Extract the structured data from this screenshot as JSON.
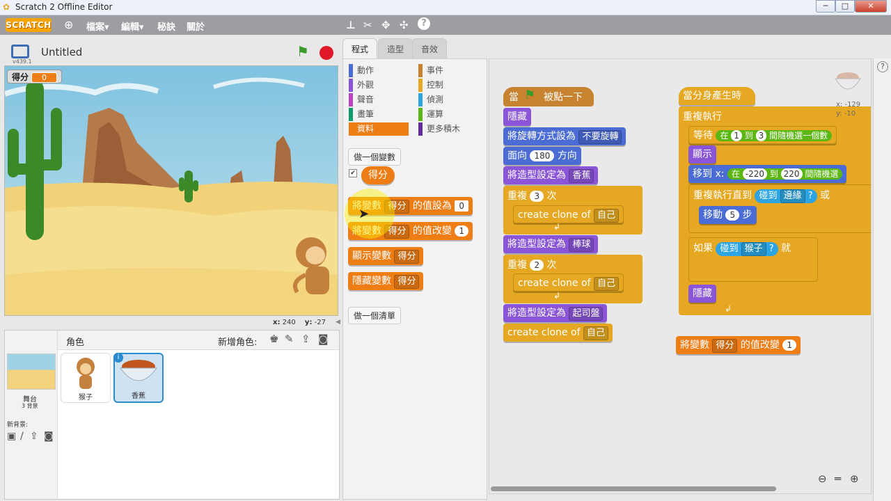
{
  "window": {
    "title": "Scratch 2 Offline Editor",
    "minimize": "─",
    "maximize": "□",
    "close": "✕"
  },
  "menubar": {
    "logo": "SCRATCH",
    "globe_icon": "globe-icon",
    "items": [
      "檔案▾",
      "編輯▾",
      "秘訣",
      "關於"
    ],
    "tools": [
      "duplicate-icon",
      "delete-icon",
      "grow-icon",
      "shrink-icon",
      "help-icon"
    ]
  },
  "stage": {
    "project_title": "Untitled",
    "version": "v439.1",
    "monitor": {
      "label": "得分",
      "value": "0"
    },
    "coords": {
      "x_label": "x:",
      "x": "240",
      "y_label": "y:",
      "y": "-27"
    }
  },
  "sprites": {
    "header": "角色",
    "new_sprite": "新增角色:",
    "stage_name": "舞台",
    "stage_backdrops": "3 背景",
    "new_backdrop": "新背景:",
    "items": [
      {
        "name": "猴子"
      },
      {
        "name": "香蕉"
      }
    ]
  },
  "tabs": [
    "程式",
    "造型",
    "音效"
  ],
  "categories": {
    "left": [
      {
        "label": "動作",
        "color": "#4a6cd4"
      },
      {
        "label": "外觀",
        "color": "#8a55d7"
      },
      {
        "label": "聲音",
        "color": "#bb42c3"
      },
      {
        "label": "畫筆",
        "color": "#0e9a6c"
      },
      {
        "label": "資料",
        "color": "#ee7d16",
        "selected": true
      }
    ],
    "right": [
      {
        "label": "事件",
        "color": "#c88330"
      },
      {
        "label": "控制",
        "color": "#e6a822"
      },
      {
        "label": "偵測",
        "color": "#2ca5e2"
      },
      {
        "label": "運算",
        "color": "#5cb712"
      },
      {
        "label": "更多積木",
        "color": "#632d99"
      }
    ]
  },
  "palette": {
    "make_variable": "做一個變數",
    "var_reporter": "得分",
    "set_block": {
      "a": "將變數",
      "var": "得分",
      "b": "的值設為",
      "val": "0"
    },
    "change_block": {
      "a": "將變數",
      "var": "得分",
      "b": "的值改變",
      "val": "1"
    },
    "show_var": {
      "a": "顯示變數",
      "var": "得分"
    },
    "hide_var": {
      "a": "隱藏變數",
      "var": "得分"
    },
    "make_list": "做一個清單"
  },
  "script1": {
    "hat": {
      "a": "當",
      "b": "被點一下"
    },
    "hide": "隱藏",
    "rot": {
      "a": "將旋轉方式設為",
      "v": "不要旋轉"
    },
    "point": {
      "a": "面向",
      "v": "180",
      "b": "方向"
    },
    "costume1": {
      "a": "將造型設定為",
      "v": "香蕉"
    },
    "repeat1": {
      "a": "重複",
      "v": "3",
      "b": "次"
    },
    "clone": {
      "a": "create clone of",
      "v": "自己"
    },
    "costume2": {
      "a": "將造型設定為",
      "v": "棒球"
    },
    "repeat2": {
      "a": "重複",
      "v": "2",
      "b": "次"
    },
    "costume3": {
      "a": "將造型設定為",
      "v": "起司盤"
    }
  },
  "script2": {
    "hat": "當分身產生時",
    "forever": "重複執行",
    "wait": {
      "a": "等待",
      "b": "在",
      "v1": "1",
      "c": "到",
      "v2": "3",
      "d": "間隨機選一個數"
    },
    "show": "顯示",
    "goto": {
      "a": "移到 x:",
      "b": "在",
      "v1": "-220",
      "c": "到",
      "v2": "220",
      "d": "間隨機選"
    },
    "until": {
      "a": "重複執行直到",
      "b": "碰到",
      "v": "邊緣",
      "c": "?",
      "d": "或"
    },
    "move": {
      "a": "移動",
      "v": "5",
      "b": "步"
    },
    "if": {
      "a": "如果",
      "b": "碰到",
      "v": "猴子",
      "c": "?",
      "d": "就"
    },
    "hide": "隱藏"
  },
  "loose_block": {
    "a": "將變數",
    "var": "得分",
    "b": "的值改變",
    "val": "1"
  },
  "sprite_info": {
    "x": "x: -129",
    "y": "y: -10"
  }
}
